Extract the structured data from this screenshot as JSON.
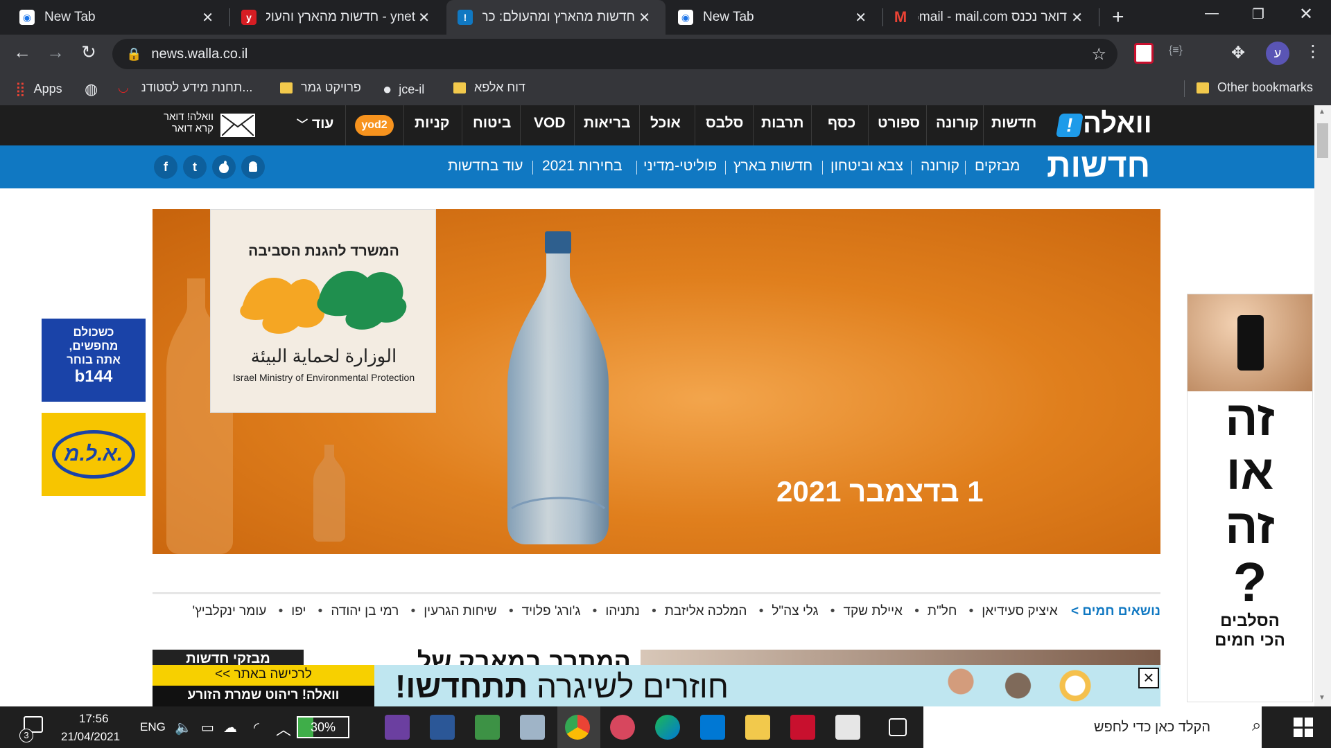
{
  "browser": {
    "tabs": [
      {
        "title": "New Tab",
        "favicon": "chrome-newtab-icon",
        "active": false
      },
      {
        "title": "ynet - חדשות מהארץ והעולם",
        "favicon": "ynet-icon",
        "active": false
      },
      {
        "title": "חדשות מהארץ ומהעולם: כת",
        "favicon": "walla-icon",
        "active": true
      },
      {
        "title": "New Tab",
        "favicon": "chrome-newtab-icon",
        "active": false
      },
      {
        "title": "דואר נכנס Gmail - mail.com",
        "favicon": "gmail-icon",
        "active": false
      }
    ],
    "new_tab_label": "+",
    "url": "news.walla.co.il",
    "profile_initial": "ע",
    "bookmarks": [
      {
        "label": "Apps",
        "icon": "apps-grid-icon"
      },
      {
        "label": "",
        "icon": "globe-icon"
      },
      {
        "label": "תחנת מידע לסטודנ...",
        "icon": "lips-icon"
      },
      {
        "label": "פרויקט גמר",
        "icon": "folder-icon"
      },
      {
        "label": "jce-il",
        "icon": "github-icon"
      },
      {
        "label": "דוח אלפא",
        "icon": "folder-icon"
      }
    ],
    "other_bookmarks": "Other bookmarks"
  },
  "walla": {
    "logo": "וואלה",
    "logo_mark": "!",
    "top_nav": [
      "חדשות",
      "קורונה",
      "ספורט",
      "כסף",
      "תרבות",
      "סלבס",
      "אוכל",
      "בריאות",
      "VOD",
      "ביטוח",
      "קניות"
    ],
    "yod2": "yod2",
    "more_label": "עוד",
    "mail_line1": "וואלה! דואר",
    "mail_line2": "קרא דואר",
    "section_title": "חדשות",
    "sub_nav": [
      "מבזקים",
      "קורונה",
      "צבא וביטחון",
      "חדשות בארץ",
      "פוליטי-מדיני",
      "בחירות 2021",
      "עוד בחדשות"
    ],
    "social": [
      {
        "label": "f",
        "icon": "facebook-icon"
      },
      {
        "label": "t",
        "icon": "twitter-icon"
      },
      {
        "label": "",
        "icon": "apple-icon"
      },
      {
        "label": "",
        "icon": "android-icon"
      }
    ]
  },
  "hero_ad": {
    "ministry_he": "המשרד להגנת הסביבה",
    "ministry_ar": "الوزارة لحماية البيئة",
    "ministry_en": "Israel Ministry of Environmental Protection",
    "date": "1 בדצמבר 2021",
    "colors": {
      "orange_light": "#f3a54c",
      "orange_dark": "#c7630c"
    }
  },
  "hot_topics": {
    "label": "נושאים חמים >",
    "items": [
      "איציק סעידיאן",
      "חל\"ת",
      "איילת שקד",
      "גלי צה\"ל",
      "המלכה אליזבת",
      "נתניהו",
      "ג'ורג' פלויד",
      "שיחות הגרעין",
      "רמי בן יהודה",
      "יפו",
      "עומר ינקלביץ'"
    ]
  },
  "headline_partial": "המתרב במאבק של",
  "flash_news_label": "מבזקי חדשות",
  "side_ads": {
    "left1": {
      "line1": "כשכולם",
      "line2": "מחפשים,",
      "line3": "אתה בוחר",
      "brand": "b144"
    },
    "left2": {
      "brand": "א.ל.מ."
    },
    "right": {
      "line1": "זה",
      "line2": "או",
      "line3": "זה",
      "q": "?",
      "sub1": "הסלבים",
      "sub2": "הכי חמים"
    }
  },
  "bottom_banner": {
    "tag1": "לרכישה באתר >>",
    "brand": "וואלה! ריהוט",
    "sub": "שמרת הזורע",
    "headline_a": "חוזרים לשיגרה",
    "headline_b": "תתחדשו!",
    "close": "×"
  },
  "taskbar": {
    "notif_count": "3",
    "time": "17:56",
    "date": "21/04/2021",
    "lang": "ENG",
    "battery": "30%",
    "search_placeholder": "הקלד כאן כדי לחפש",
    "apps": [
      "visual-studio-icon",
      "word-icon",
      "excel-icon",
      "snipping-icon",
      "chrome-icon",
      "paint-icon",
      "edge-icon",
      "mail-icon",
      "file-explorer-icon",
      "mcafee-icon",
      "store-icon",
      "task-view-icon"
    ]
  }
}
